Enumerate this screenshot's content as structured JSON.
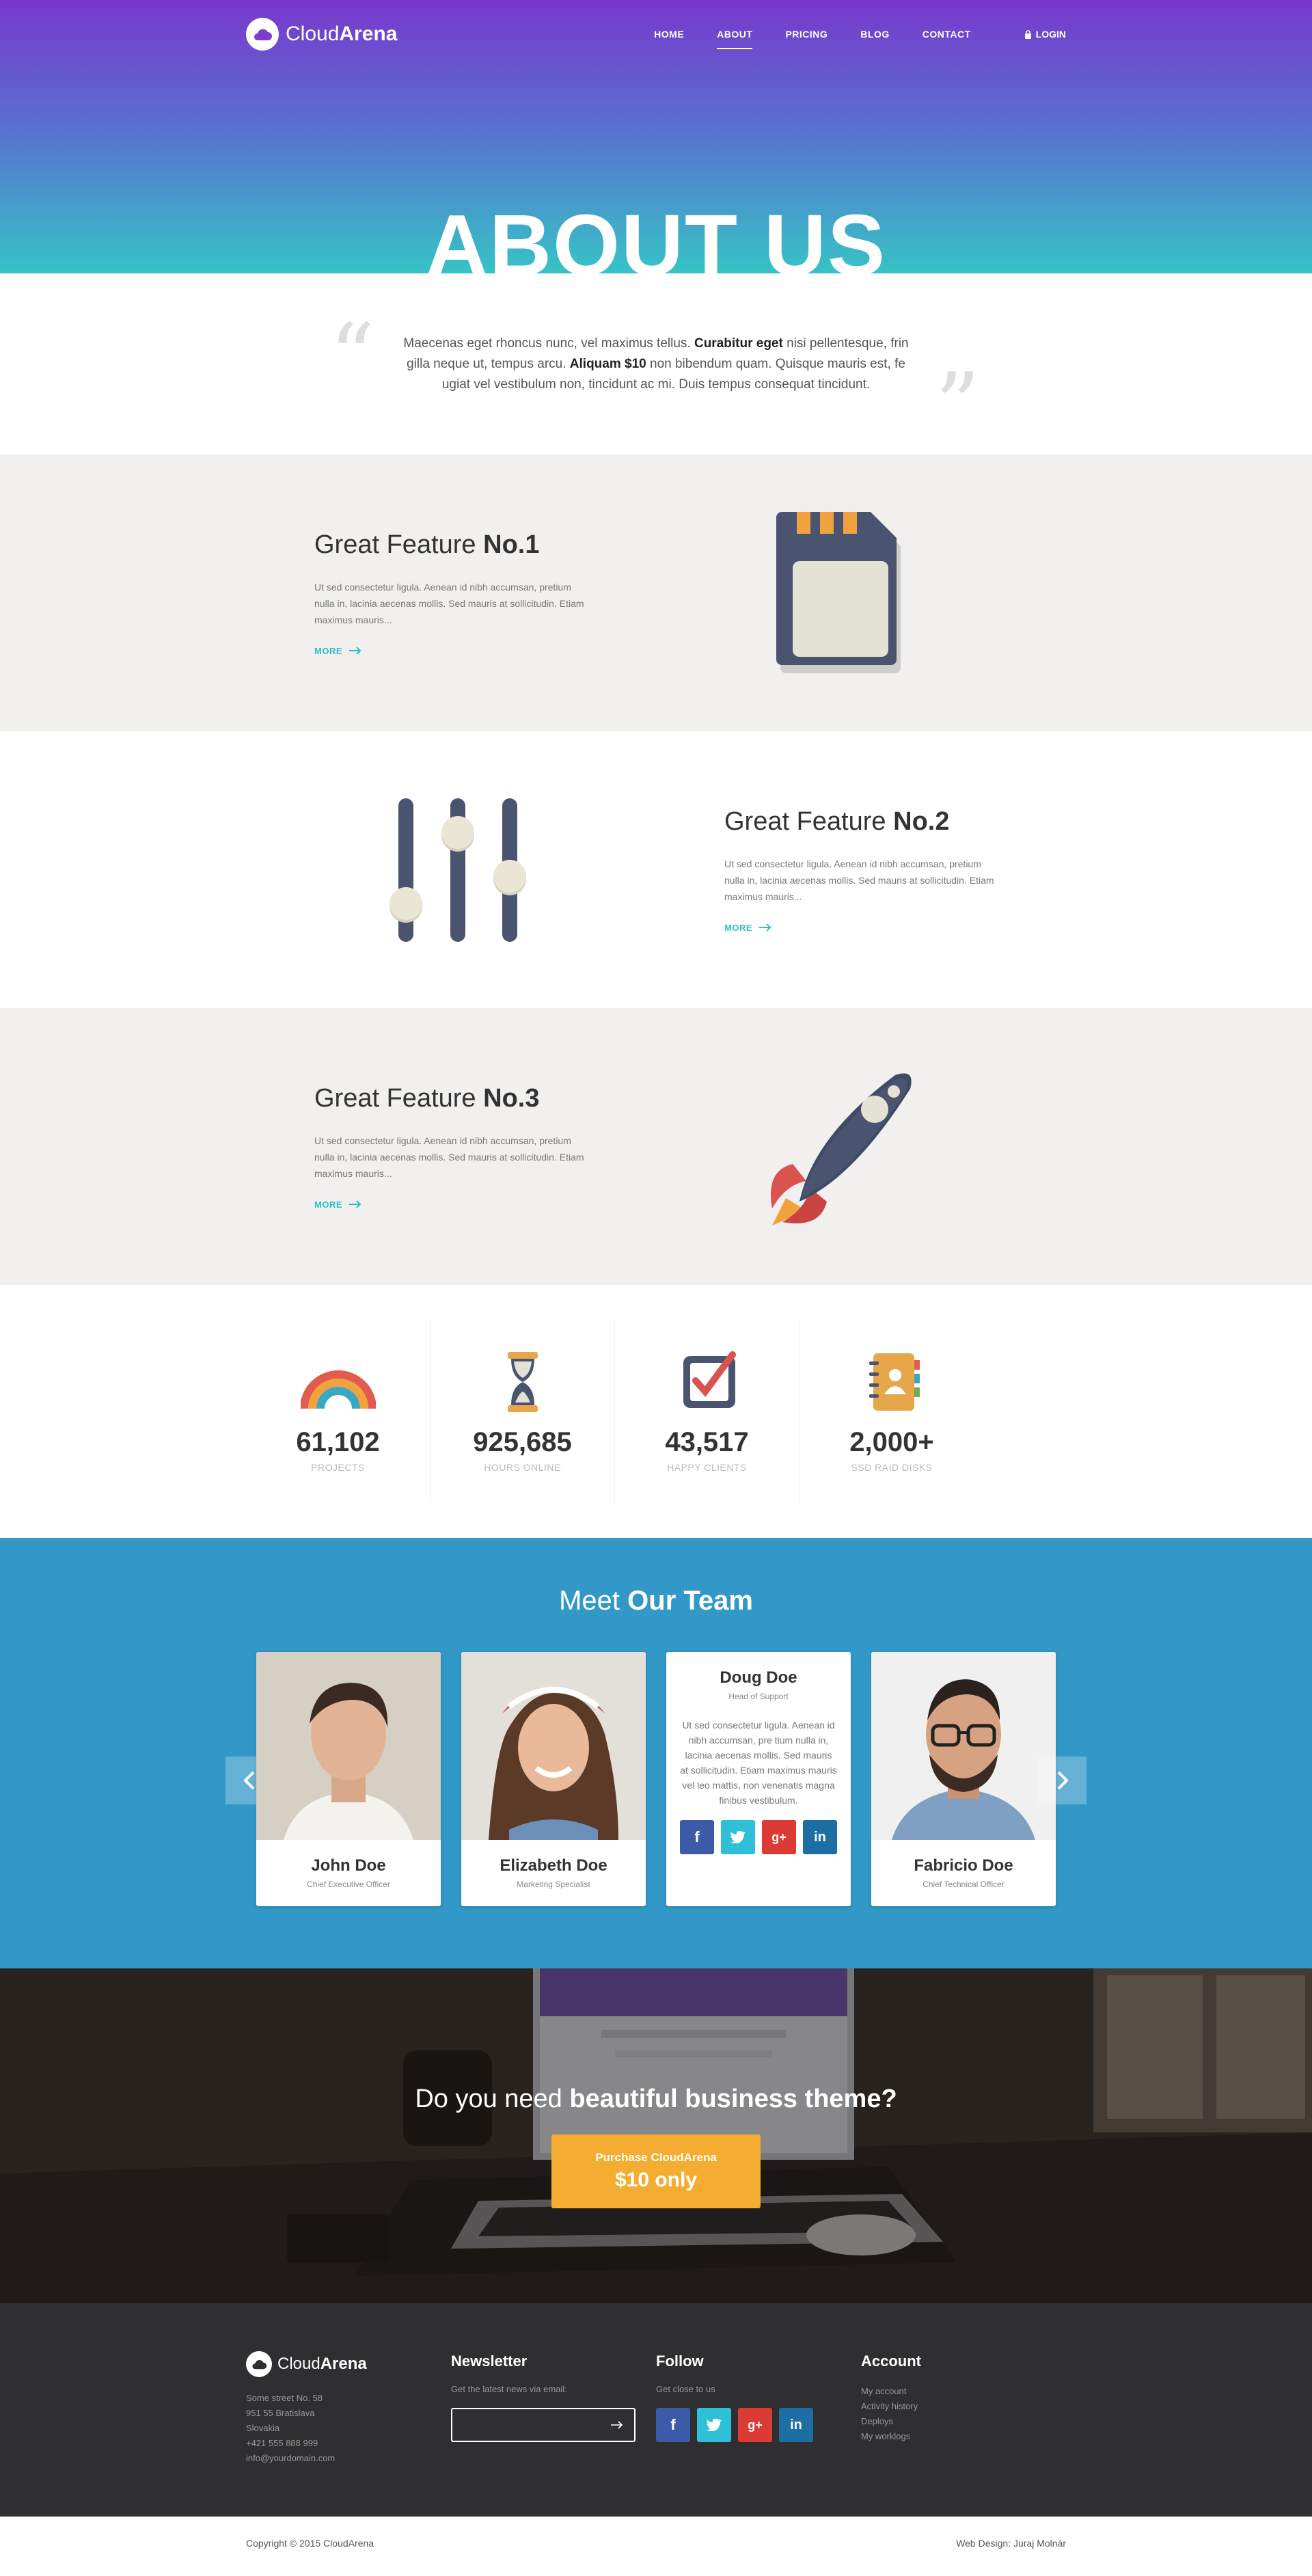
{
  "brand": {
    "name_light": "Cloud",
    "name_bold": "Arena"
  },
  "nav": {
    "items": [
      {
        "label": "HOME"
      },
      {
        "label": "ABOUT"
      },
      {
        "label": "PRICING"
      },
      {
        "label": "BLOG"
      },
      {
        "label": "CONTACT"
      }
    ],
    "active": "ABOUT",
    "login_label": "LOGIN"
  },
  "hero": {
    "title": "ABOUT US"
  },
  "quote": {
    "part1": "Maecenas eget rhoncus nunc, vel maximus tellus. ",
    "bold1": "Curabitur eget",
    "part2": " nisi pellentesque, frin gilla neque ut, tempus arcu. ",
    "bold2": "Aliquam $10",
    "part3": " non bibendum quam. Quisque mauris est, fe ugiat vel vestibulum non, tincidunt ac mi. Duis tempus consequat tincidunt."
  },
  "features": [
    {
      "title_light": "Great Feature ",
      "title_bold": "No.1",
      "text": "Ut sed consectetur ligula. Aenean id nibh accumsan, pretium nulla in, lacinia aecenas mollis. Sed mauris at sollicitudin. Etiam maximus mauris...",
      "more": "MORE",
      "icon": "sim-card-icon"
    },
    {
      "title_light": "Great Feature ",
      "title_bold": "No.2",
      "text": "Ut sed consectetur ligula. Aenean id nibh accumsan, pretium nulla in, lacinia aecenas mollis. Sed mauris at sollicitudin. Etiam maximus mauris...",
      "more": "MORE",
      "icon": "sliders-icon"
    },
    {
      "title_light": "Great Feature ",
      "title_bold": "No.3",
      "text": "Ut sed consectetur ligula. Aenean id nibh accumsan, pretium nulla in, lacinia aecenas mollis. Sed mauris at sollicitudin. Etiam maximus mauris...",
      "more": "MORE",
      "icon": "rocket-icon"
    }
  ],
  "stats": [
    {
      "value": "61,102",
      "label": "PROJECTS",
      "icon": "rainbow-icon"
    },
    {
      "value": "925,685",
      "label": "HOURS ONLINE",
      "icon": "hourglass-icon"
    },
    {
      "value": "43,517",
      "label": "HAPPY CLIENTS",
      "icon": "checkbox-icon"
    },
    {
      "value": "2,000+",
      "label": "SSD RAID DISKS",
      "icon": "contacts-book-icon"
    }
  ],
  "team": {
    "title_light": "Meet ",
    "title_bold": "Our Team",
    "members": [
      {
        "name": "John Doe",
        "role": "Chief Executive Officer"
      },
      {
        "name": "Elizabeth Doe",
        "role": "Marketing Specialist"
      },
      {
        "name": "Doug Doe",
        "role": "Head of Support",
        "bio": "Ut sed consectetur ligula. Aenean id nibh accumsan, pre tium nulla in, lacinia aecenas mollis. Sed mauris at sollicitudin. Etiam maximus mauris vel leo mattis, non venenatis magna finibus vestibulum."
      },
      {
        "name": "Fabricio Doe",
        "role": "Chief Technical Officer"
      }
    ]
  },
  "cta": {
    "title_light": "Do you need ",
    "title_bold": "beautiful business theme?",
    "button_line1": "Purchase CloudArena",
    "button_line2": "$10 only"
  },
  "footer": {
    "address": [
      "Some street No. 58",
      "951 55 Bratislava",
      "Slovakia",
      "+421 555 888 999",
      "info@yourdomain.com"
    ],
    "newsletter_title": "Newsletter",
    "newsletter_sub": "Get the latest news via email:",
    "follow_title": "Follow",
    "follow_sub": "Get close to us",
    "account_title": "Account",
    "account_links": [
      "My account",
      "Activity history",
      "Deploys",
      "My worklogs"
    ]
  },
  "bottom": {
    "copyright": "Copyright © 2015 CloudArena",
    "credit": "Web Design: Juraj Molnár"
  },
  "colors": {
    "accent": "#2ec0c6",
    "gradient_top": "#7838cc",
    "gradient_bottom": "#36c3c6",
    "team_bg": "#3298c8",
    "cta_button": "#f5ad31",
    "footer_bg": "#2f2f31"
  }
}
